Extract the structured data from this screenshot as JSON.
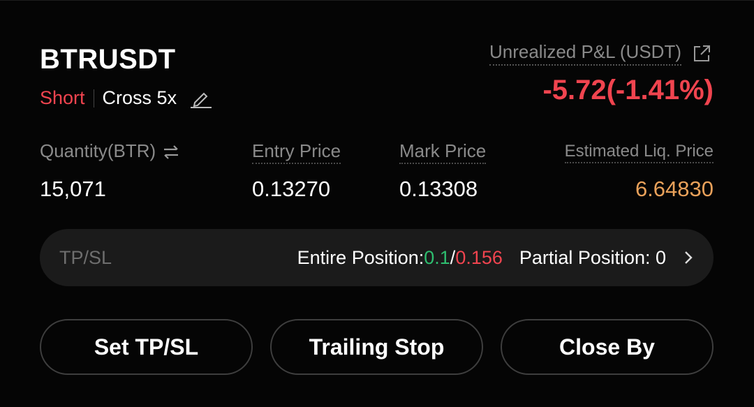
{
  "position": {
    "symbol": "BTRUSDT",
    "side": "Short",
    "margin_mode": "Cross 5x",
    "pnl_label": "Unrealized P&L (USDT)",
    "pnl_value": "-5.72(-1.41%)"
  },
  "stats": [
    {
      "label": "Quantity(BTR)",
      "value": "15,071"
    },
    {
      "label": "Entry Price",
      "value": "0.13270"
    },
    {
      "label": "Mark Price",
      "value": "0.13308"
    },
    {
      "label": "Estimated Liq. Price",
      "value": "6.64830"
    }
  ],
  "tpsl": {
    "label": "TP/SL",
    "entire_label": "Entire Position: ",
    "tp": "0.1",
    "slash": "/",
    "sl": "0.156",
    "partial_label": "Partial Position: 0"
  },
  "buttons": {
    "set_tpsl": "Set TP/SL",
    "trailing_stop": "Trailing Stop",
    "close_by": "Close By"
  },
  "colors": {
    "short": "#f0444f",
    "profit": "#2ebd6f",
    "loss": "#f0444f",
    "liq": "#e9a15a"
  },
  "icons": [
    "edit-icon",
    "external-link-icon",
    "swap-icon",
    "chevron-right-icon"
  ]
}
